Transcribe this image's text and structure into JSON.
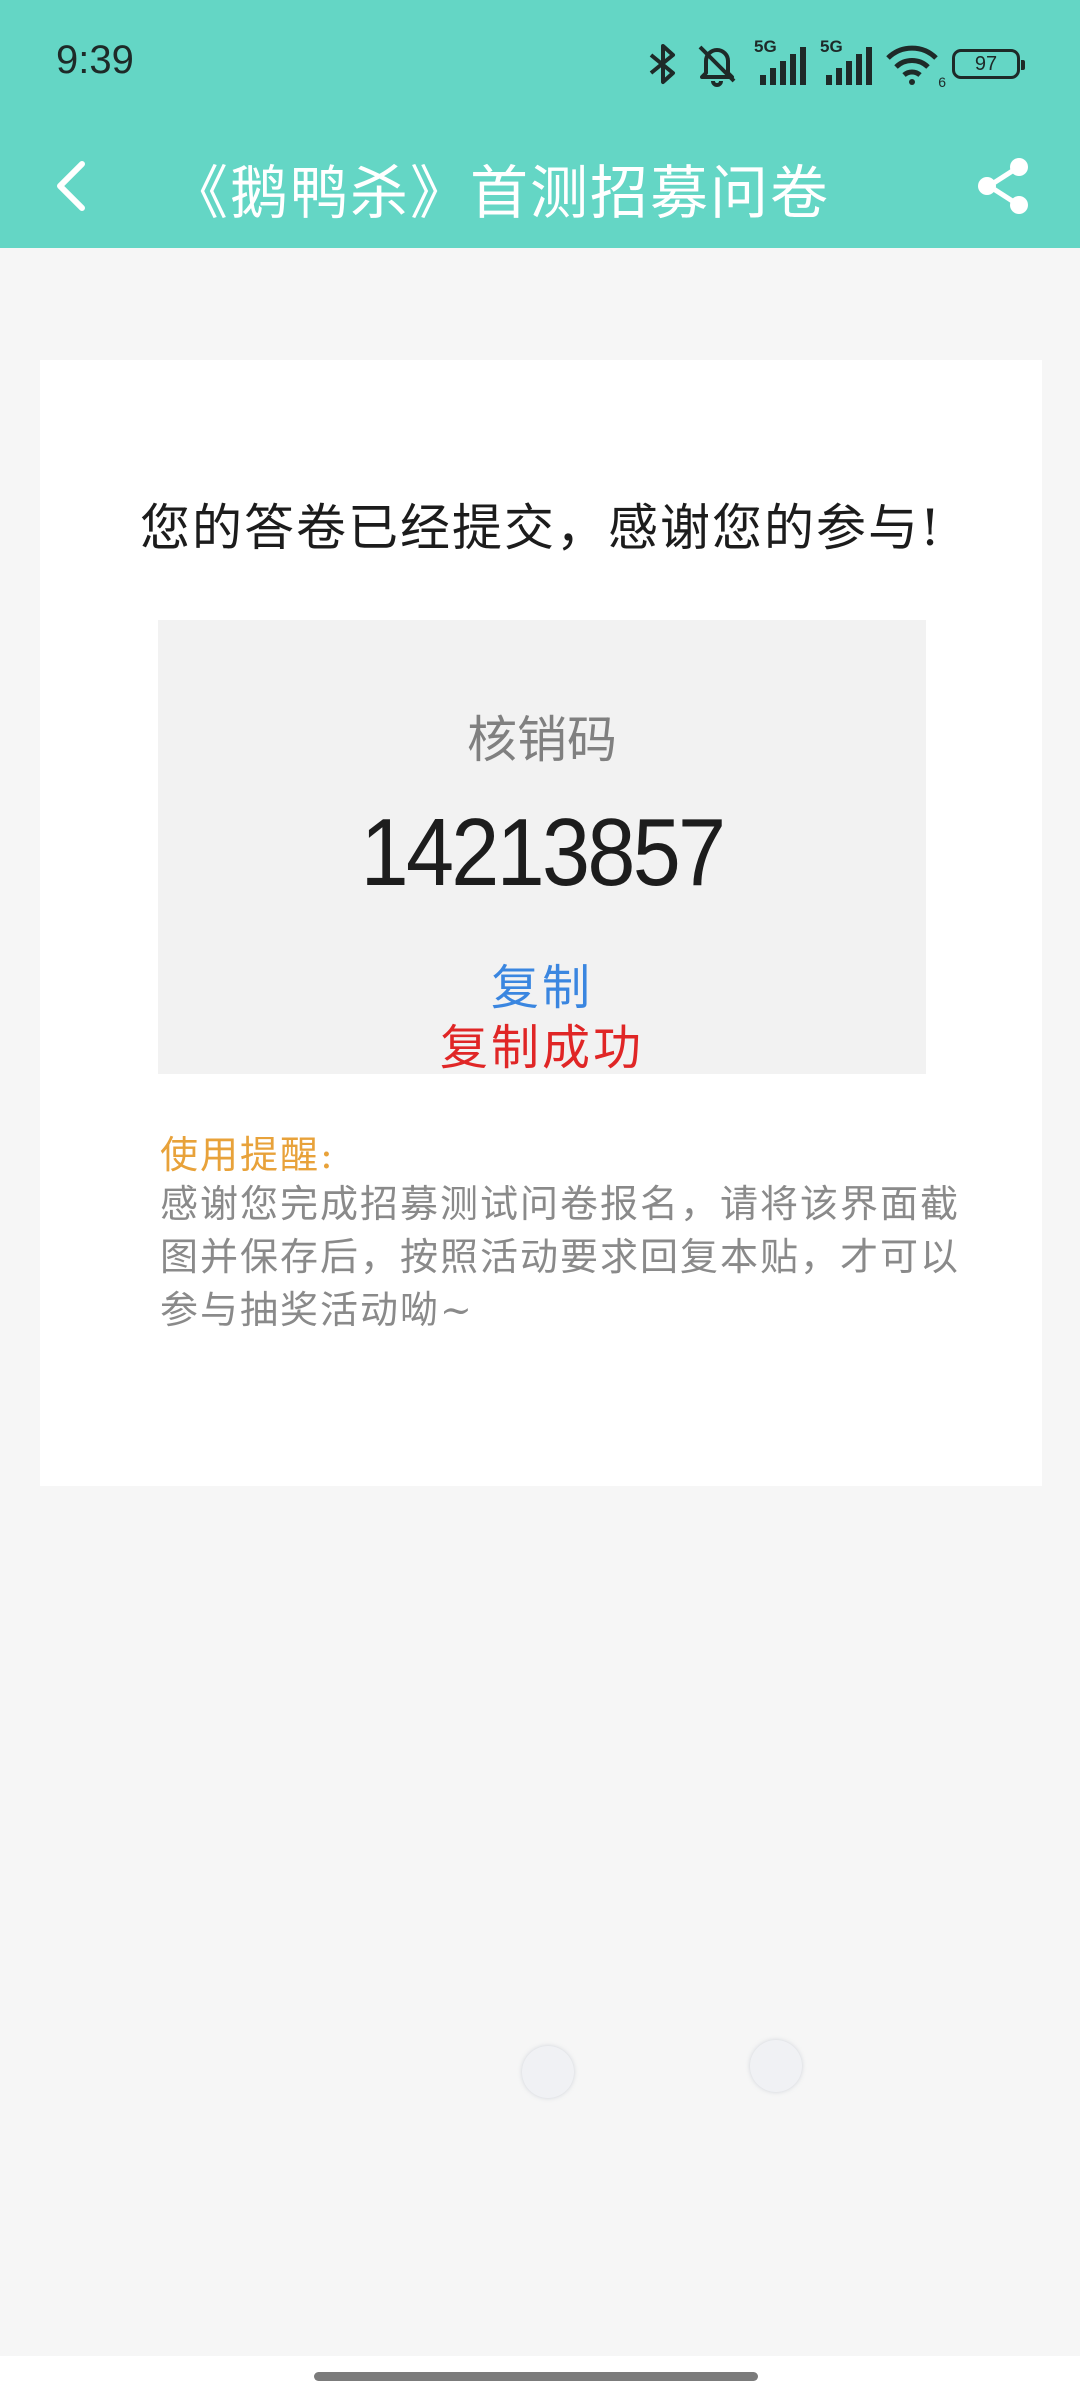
{
  "status_bar": {
    "time": "9:39",
    "network_1": "5G",
    "network_2": "5G",
    "wifi_sub": "6",
    "battery": "97"
  },
  "nav": {
    "title": "《鹅鸭杀》首测招募问卷"
  },
  "card": {
    "message": "您的答卷已经提交，感谢您的参与!",
    "code_label": "核销码",
    "code_value": "14213857",
    "copy_label": "复制",
    "copy_success": "复制成功",
    "reminder_title": "使用提醒:",
    "reminder_text": "感谢您完成招募测试问卷报名，请将该界面截图并保存后，按照活动要求回复本贴，才可以参与抽奖活动呦~"
  },
  "colors": {
    "header": "#64d6c5",
    "copy_link": "#3a86e0",
    "success": "#e02626",
    "reminder_title": "#e8a23a"
  },
  "icons": [
    "back-arrow-icon",
    "share-icon",
    "bluetooth-icon",
    "bell-off-icon",
    "signal-icon",
    "wifi-icon",
    "battery-icon"
  ]
}
